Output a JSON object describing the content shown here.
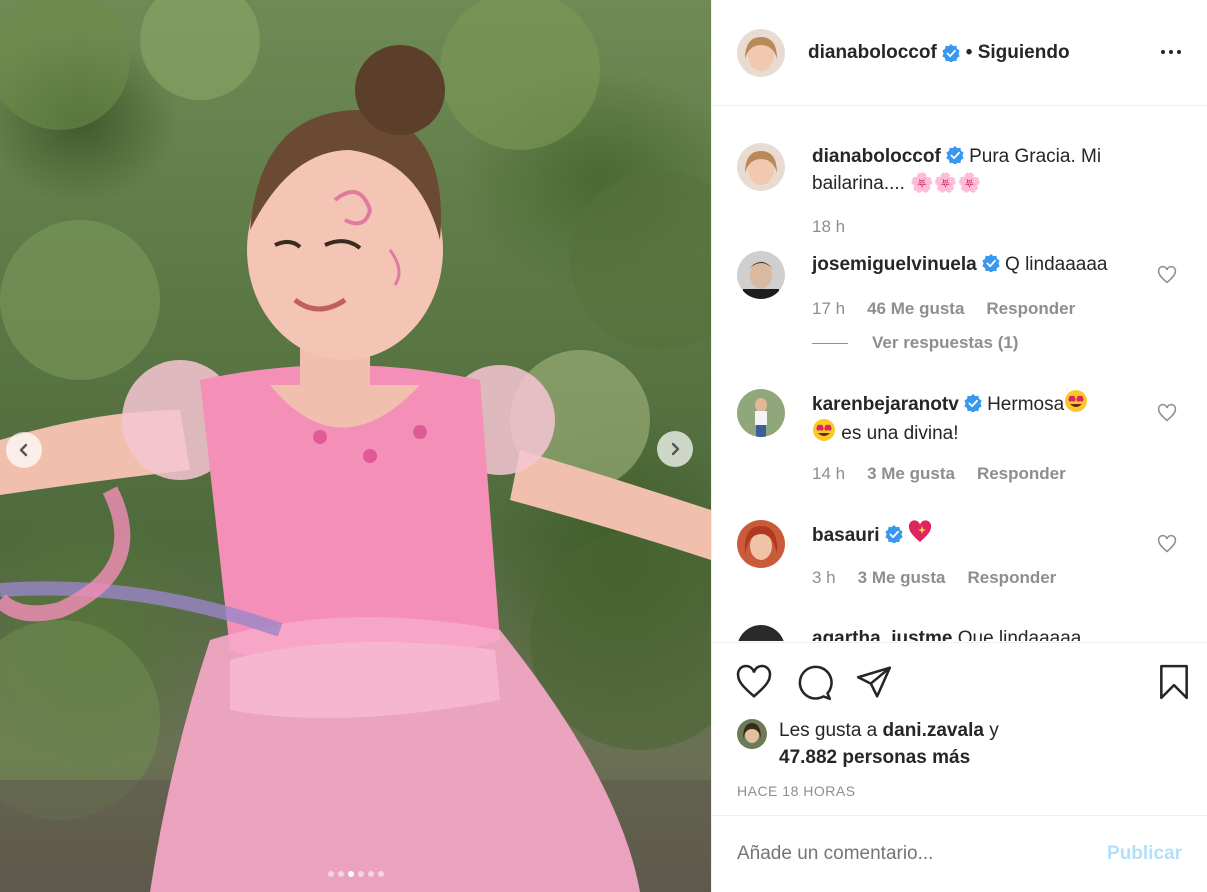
{
  "post": {
    "author": "dianaboloccof",
    "follow_status": "• Siguiendo",
    "caption_text": "Pura Gracia. Mi bailarina....",
    "caption_emojis": "🌸🌸🌸",
    "caption_time": "18 h",
    "carousel": {
      "total": 6,
      "active_index": 2
    }
  },
  "comments": [
    {
      "user": "josemiguelvinuela",
      "text": "Q lindaaaaa",
      "time": "17 h",
      "likes": "46 Me gusta",
      "reply": "Responder",
      "view_replies": "Ver respuestas (1)"
    },
    {
      "user": "karenbejaranotv",
      "text": "Hermosa",
      "text2": "es una divina!",
      "time": "14 h",
      "likes": "3 Me gusta",
      "reply": "Responder"
    },
    {
      "user": "basauri",
      "text": "",
      "time": "3 h",
      "likes": "3 Me gusta",
      "reply": "Responder"
    },
    {
      "user": "agartha_justme",
      "text": "Que lindaaaaa"
    }
  ],
  "likes_summary": {
    "prefix": "Les gusta a",
    "user": "dani.zavala",
    "connector": "y",
    "count": "47.882 personas más"
  },
  "timestamp": "HACE 18 HORAS",
  "add_comment": {
    "placeholder": "Añade un comentario...",
    "post_label": "Publicar"
  },
  "colors": {
    "verified": "#3897f0",
    "post_disabled": "#b2dffc",
    "muted": "#8e8e8e"
  }
}
